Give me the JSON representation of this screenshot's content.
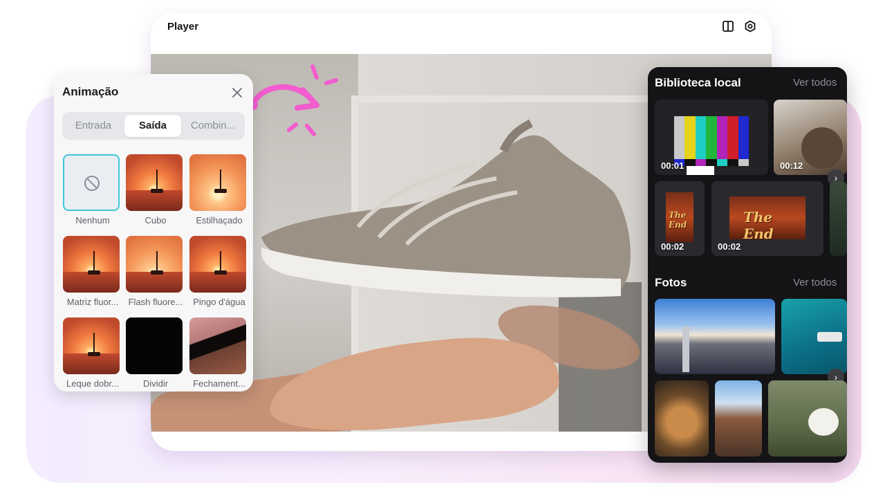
{
  "player": {
    "title": "Player",
    "icons": [
      "split-view-icon",
      "settings-icon"
    ]
  },
  "animation_panel": {
    "title": "Animação",
    "tabs": [
      {
        "label": "Entrada",
        "active": false
      },
      {
        "label": "Saída",
        "active": true
      },
      {
        "label": "Combin...",
        "active": false
      }
    ],
    "items": [
      {
        "label": "Nenhum",
        "thumb": "none",
        "selected": true
      },
      {
        "label": "Cubo",
        "thumb": "sunset"
      },
      {
        "label": "Estilhaçado",
        "thumb": "sunset2"
      },
      {
        "label": "Matriz fluor...",
        "thumb": "sunset"
      },
      {
        "label": "Flash fluore...",
        "thumb": "sunset2"
      },
      {
        "label": "Pingo d'água",
        "thumb": "sunset"
      },
      {
        "label": "Leque dobr...",
        "thumb": "sunset"
      },
      {
        "label": "Dividir",
        "thumb": "black"
      },
      {
        "label": "Fechament...",
        "thumb": "fech"
      }
    ]
  },
  "library": {
    "local_title": "Biblioteca local",
    "local_more": "Ver todos",
    "videos": [
      {
        "duration": "00:01",
        "kind": "color-bars"
      },
      {
        "duration": "00:12",
        "kind": "animal"
      },
      {
        "duration": "00:02",
        "kind": "the-end-portrait"
      },
      {
        "duration": "00:02",
        "kind": "the-end"
      }
    ],
    "the_end_text": "The End",
    "photos_title": "Fotos",
    "photos_more": "Ver todos",
    "photos": [
      "city-skyline",
      "boat-sea",
      "tacos",
      "street",
      "puppy"
    ]
  },
  "colors": {
    "accent_pink": "#f25ccf",
    "selected_border": "#3ec6d6",
    "library_bg": "#141417"
  }
}
